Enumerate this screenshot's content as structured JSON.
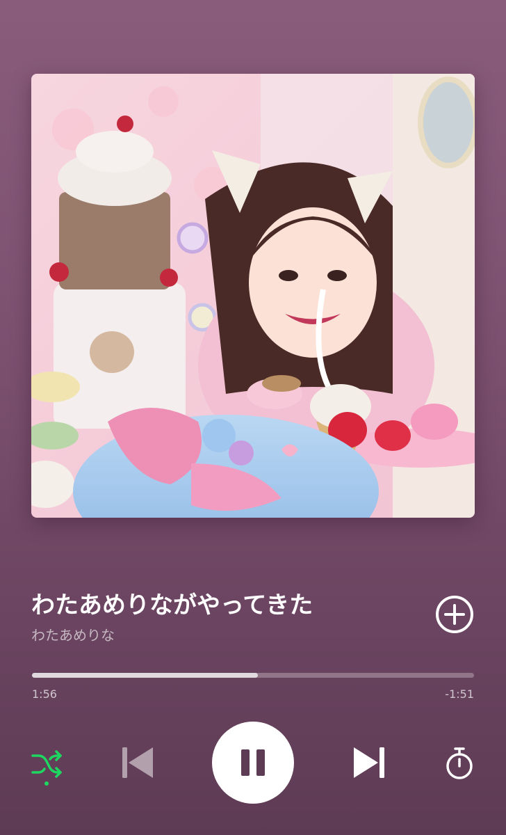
{
  "track": {
    "title": "わたあめりながやってきた",
    "artist": "わたあめりな"
  },
  "artwork": {
    "description_icon": "album-artwork"
  },
  "progress": {
    "elapsed": "1:56",
    "remaining": "-1:51",
    "fraction": 0.511
  },
  "controls": {
    "add_icon": "plus-circle-icon",
    "shuffle_icon": "shuffle-icon",
    "shuffle_active": true,
    "previous_icon": "skip-previous-icon",
    "play_state_icon": "pause-icon",
    "next_icon": "skip-next-icon",
    "timer_icon": "stopwatch-icon"
  },
  "colors": {
    "accent": "#1ed760",
    "background_top": "#8a5c7c",
    "background_bottom": "#5e3b55"
  }
}
